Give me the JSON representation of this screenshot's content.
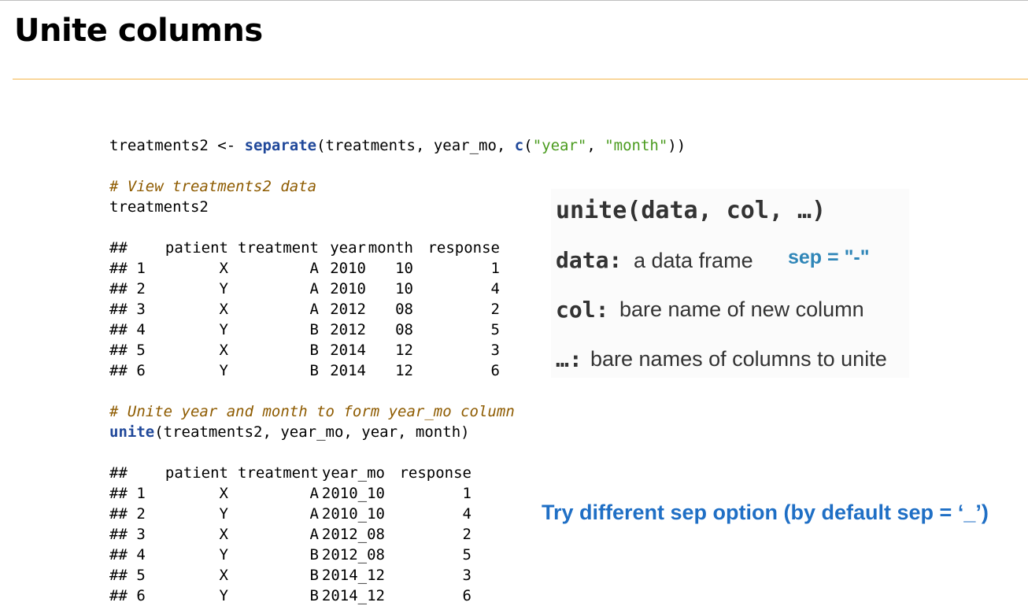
{
  "slide": {
    "title": "Unite columns"
  },
  "code": {
    "call1": {
      "lhs": "treatments2 <- ",
      "fn": "separate",
      "args_start": "(treatments, year_mo, ",
      "c_fn": "c",
      "paren_open": "(",
      "str1": "\"year\"",
      "comma": ", ",
      "str2": "\"month\"",
      "close": "))"
    },
    "comment1": "# View treatments2 data",
    "print_stmt": "treatments2",
    "table1": {
      "prefix": "##",
      "headers": [
        "",
        "patient",
        "treatment",
        "year",
        "month",
        "response"
      ],
      "rows": [
        [
          "## 1",
          "X",
          "A",
          "2010",
          "10",
          "1"
        ],
        [
          "## 2",
          "Y",
          "A",
          "2010",
          "10",
          "4"
        ],
        [
          "## 3",
          "X",
          "A",
          "2012",
          "08",
          "2"
        ],
        [
          "## 4",
          "Y",
          "B",
          "2012",
          "08",
          "5"
        ],
        [
          "## 5",
          "X",
          "B",
          "2014",
          "12",
          "3"
        ],
        [
          "## 6",
          "Y",
          "B",
          "2014",
          "12",
          "6"
        ]
      ]
    },
    "comment2": "# Unite year and month to form year_mo column",
    "call2": {
      "fn": "unite",
      "args": "(treatments2, year_mo, year, month)"
    },
    "table2": {
      "prefix": "##",
      "headers": [
        "",
        "patient",
        "treatment",
        "year_mo",
        "response"
      ],
      "rows": [
        [
          "## 1",
          "X",
          "A",
          "2010_10",
          "1"
        ],
        [
          "## 2",
          "Y",
          "A",
          "2010_10",
          "4"
        ],
        [
          "## 3",
          "X",
          "A",
          "2012_08",
          "2"
        ],
        [
          "## 4",
          "Y",
          "B",
          "2012_08",
          "5"
        ],
        [
          "## 5",
          "X",
          "B",
          "2014_12",
          "3"
        ],
        [
          "## 6",
          "Y",
          "B",
          "2014_12",
          "6"
        ]
      ]
    }
  },
  "syntax": {
    "signature": "unite(data, col, …)",
    "data_arg": "data:",
    "data_desc": "a data frame",
    "col_arg": "col:",
    "col_desc": "bare name of new column",
    "dots_arg": "…:",
    "dots_desc": "bare names of columns to unite"
  },
  "sep_note": "sep = \"-\"",
  "hint": "Try different sep option (by default sep = ‘_’)",
  "colors": {
    "title_rule": "#f5b54a",
    "function": "#20489a",
    "string": "#4a9b1e",
    "comment": "#8e5b00",
    "sep_note": "#2f86b8",
    "hint": "#1f6fc5"
  }
}
